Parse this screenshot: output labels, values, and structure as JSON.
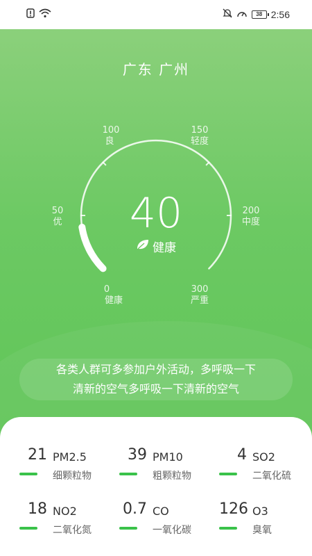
{
  "status_bar": {
    "time": "2:56",
    "battery": "38",
    "icons": [
      "sim-alert-icon",
      "wifi-icon",
      "mute-icon",
      "speed-icon",
      "battery-icon"
    ]
  },
  "location": "广东 广州",
  "gauge": {
    "value": 40,
    "max": 300,
    "level_text": "健康",
    "ticks": [
      {
        "num": "0",
        "label": "健康"
      },
      {
        "num": "50",
        "label": "优"
      },
      {
        "num": "100",
        "label": "良"
      },
      {
        "num": "150",
        "label": "轻度"
      },
      {
        "num": "200",
        "label": "中度"
      },
      {
        "num": "300",
        "label": "严重"
      }
    ]
  },
  "advice": {
    "line1": "各类人群可多参加户外活动，多呼吸一下",
    "line2": "清新的空气多呼吸一下清新的空气"
  },
  "pollutants": [
    {
      "value": "21",
      "name": "PM2.5",
      "cn": "细颗粒物"
    },
    {
      "value": "39",
      "name": "PM10",
      "cn": "粗颗粒物"
    },
    {
      "value": "4",
      "name": "SO2",
      "cn": "二氧化硫"
    },
    {
      "value": "18",
      "name": "NO2",
      "cn": "二氧化氮"
    },
    {
      "value": "0.7",
      "name": "CO",
      "cn": "一氧化碳"
    },
    {
      "value": "126",
      "name": "O3",
      "cn": "臭氧"
    }
  ],
  "colors": {
    "hero_top": "#8bd07b",
    "hero_bottom": "#5fc557",
    "accent": "#3ac24a"
  }
}
